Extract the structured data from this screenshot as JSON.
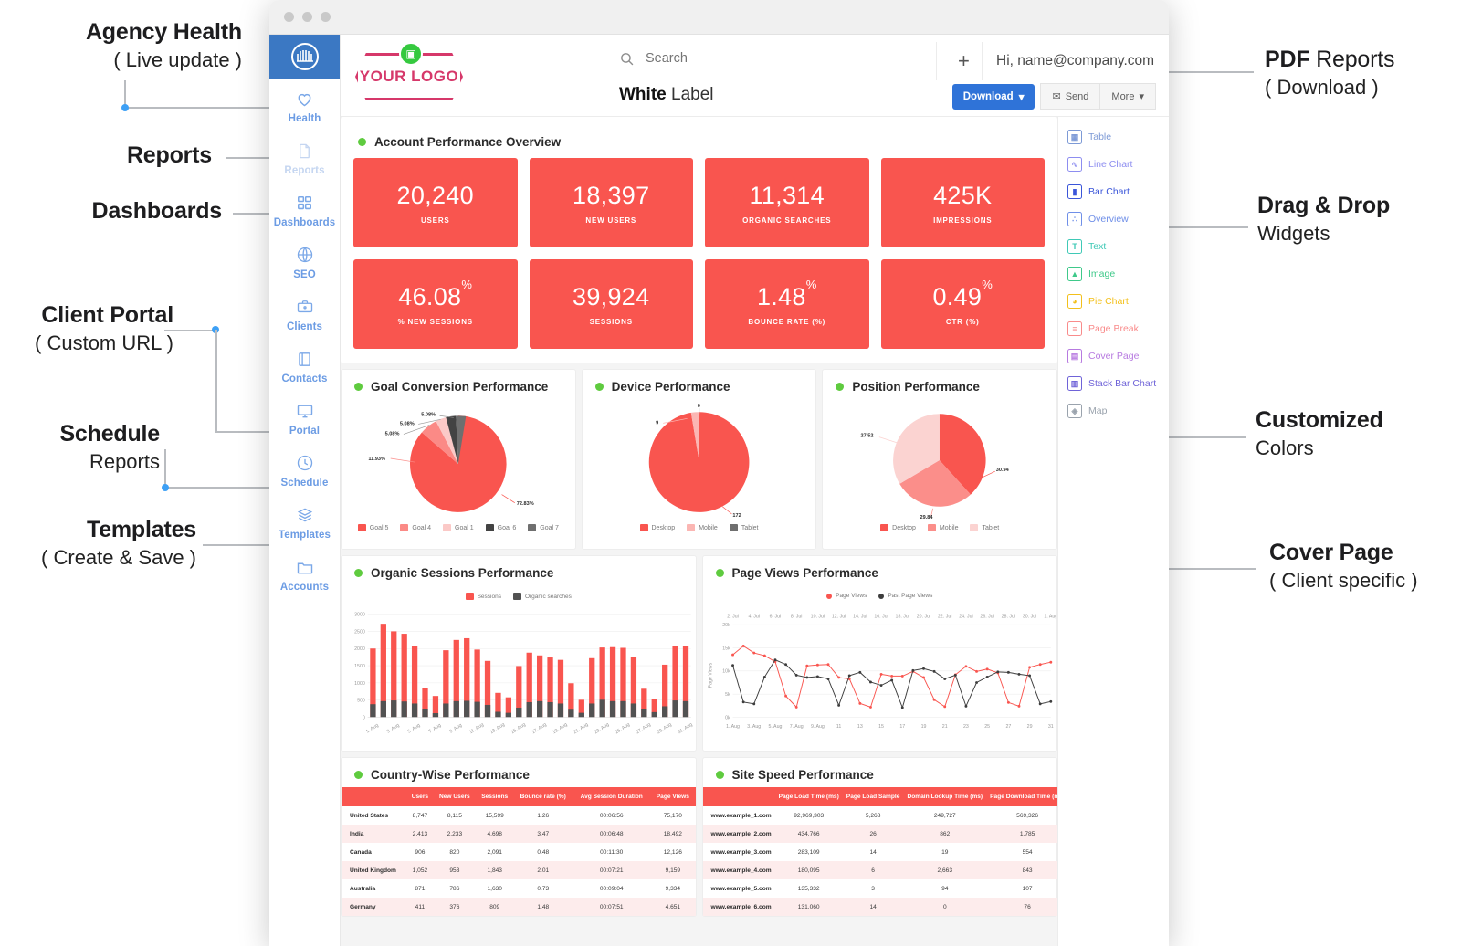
{
  "annotations": {
    "left": [
      {
        "id": "agency-health",
        "title": "Agency Health",
        "title_thin": "",
        "sub": "( Live update )"
      },
      {
        "id": "reports",
        "title": "Reports",
        "sub": ""
      },
      {
        "id": "dashboards",
        "title": "Dashboards",
        "sub": ""
      },
      {
        "id": "client-portal",
        "title": "Client Portal",
        "sub": "( Custom URL )"
      },
      {
        "id": "schedule",
        "title": "Schedule",
        "sub": "Reports"
      },
      {
        "id": "templates",
        "title": "Templates",
        "sub": "( Create & Save )"
      }
    ],
    "right": [
      {
        "id": "pdf-reports",
        "title": "PDF",
        "title_thin": " Reports",
        "sub": "( Download )"
      },
      {
        "id": "drag-drop",
        "title": "Drag & Drop",
        "sub": "Widgets"
      },
      {
        "id": "customized-colors",
        "title": "Customized",
        "sub": "Colors"
      },
      {
        "id": "cover-page",
        "title": "Cover Page",
        "sub": "( Client specific )"
      }
    ]
  },
  "sidebar": {
    "items": [
      {
        "label": "Health",
        "icon": "heart-icon"
      },
      {
        "label": "Reports",
        "icon": "file-icon"
      },
      {
        "label": "Dashboards",
        "icon": "grid-icon"
      },
      {
        "label": "SEO",
        "icon": "globe-icon"
      },
      {
        "label": "Clients",
        "icon": "briefcase-icon"
      },
      {
        "label": "Contacts",
        "icon": "contacts-book-icon"
      },
      {
        "label": "Portal",
        "icon": "monitor-icon"
      },
      {
        "label": "Schedule",
        "icon": "clock-icon"
      },
      {
        "label": "Templates",
        "icon": "layers-icon"
      },
      {
        "label": "Accounts",
        "icon": "folder-icon"
      }
    ]
  },
  "header": {
    "logo_text": "YOUR LOGO",
    "search_placeholder": "Search",
    "search_value": "",
    "plus_label": "+",
    "greeting": "Hi, name@company.com",
    "report_title_bold": "White",
    "report_title_thin": " Label",
    "download_label": "Download",
    "send_label": "Send",
    "more_label": "More"
  },
  "widget_panel": {
    "items": [
      {
        "label": "Table",
        "icon": "table-icon",
        "color": "#7d9ad6",
        "glyph": "▦"
      },
      {
        "label": "Line Chart",
        "icon": "line-chart-icon",
        "color": "#8d8df0",
        "glyph": "∿"
      },
      {
        "label": "Bar Chart",
        "icon": "bar-chart-icon",
        "color": "#3a55d9",
        "glyph": "▮"
      },
      {
        "label": "Overview",
        "icon": "overview-icon",
        "color": "#6f8fe8",
        "glyph": "∴"
      },
      {
        "label": "Text",
        "icon": "text-icon",
        "color": "#3fc9b6",
        "glyph": "T"
      },
      {
        "label": "Image",
        "icon": "image-icon",
        "color": "#3fc98a",
        "glyph": "▲"
      },
      {
        "label": "Pie Chart",
        "icon": "pie-chart-icon",
        "color": "#f3c01b",
        "glyph": "◕"
      },
      {
        "label": "Page Break",
        "icon": "page-break-icon",
        "color": "#f98b8b",
        "glyph": "≡"
      },
      {
        "label": "Cover Page",
        "icon": "cover-page-icon",
        "color": "#b77ae0",
        "glyph": "▤"
      },
      {
        "label": "Stack Bar Chart",
        "icon": "stack-bar-chart-icon",
        "color": "#6f63d8",
        "glyph": "▥"
      },
      {
        "label": "Map",
        "icon": "map-icon",
        "color": "#9aa3ad",
        "glyph": "◈"
      }
    ]
  },
  "overview": {
    "title": "Account Performance Overview",
    "kpis": [
      {
        "value": "20,240",
        "suffix": "",
        "label": "USERS"
      },
      {
        "value": "18,397",
        "suffix": "",
        "label": "NEW USERS"
      },
      {
        "value": "11,314",
        "suffix": "",
        "label": "ORGANIC SEARCHES"
      },
      {
        "value": "425K",
        "suffix": "",
        "label": "IMPRESSIONS"
      },
      {
        "value": "46.08",
        "suffix": "%",
        "label": "% NEW SESSIONS"
      },
      {
        "value": "39,924",
        "suffix": "",
        "label": "SESSIONS"
      },
      {
        "value": "1.48",
        "suffix": "%",
        "label": "BOUNCE RATE (%)"
      },
      {
        "value": "0.49",
        "suffix": "%",
        "label": "CTR (%)"
      }
    ]
  },
  "cards": {
    "goal_conversion": "Goal Conversion Performance",
    "device": "Device Performance",
    "position": "Position Performance",
    "organic_sessions": "Organic Sessions Performance",
    "page_views": "Page Views Performance",
    "country_wise": "Country-Wise Performance",
    "site_speed": "Site Speed Performance"
  },
  "chart_data": [
    {
      "type": "pie",
      "title": "Goal Conversion Performance",
      "categories": [
        "Goal 5",
        "Goal 4",
        "Goal 1",
        "Goal 6",
        "Goal 7"
      ],
      "values": [
        72.83,
        11.93,
        5.08,
        5.08,
        5.08
      ],
      "labels": [
        "72.83%",
        "11.93%",
        "5.08%",
        "5.08%",
        "5.08%"
      ],
      "colors": [
        "#f9554f",
        "#fb8a86",
        "#fbc9c7",
        "#434343",
        "#6f6f6f"
      ],
      "legend": "bottom"
    },
    {
      "type": "pie",
      "title": "Device Performance",
      "categories": [
        "Desktop",
        "Mobile",
        "Tablet"
      ],
      "values": [
        172,
        9,
        0
      ],
      "labels": [
        "172",
        "9",
        "0"
      ],
      "colors": [
        "#f9554f",
        "#fbb6b3",
        "#6f6f6f"
      ],
      "legend": "bottom"
    },
    {
      "type": "pie",
      "title": "Position Performance",
      "categories": [
        "Desktop",
        "Mobile",
        "Tablet"
      ],
      "values": [
        30.94,
        29.84,
        27.52
      ],
      "labels": [
        "30.94",
        "29.84",
        "27.52"
      ],
      "colors": [
        "#f9554f",
        "#fb8e8a",
        "#fbd3d1"
      ],
      "legend": "bottom"
    },
    {
      "type": "bar",
      "title": "Organic Sessions Performance",
      "xlabel": "",
      "ylabel": "",
      "ylim": [
        0,
        3000
      ],
      "yticks": [
        "0",
        "500",
        "1000",
        "1500",
        "2000",
        "2500",
        "3000"
      ],
      "categories": [
        "1. Aug",
        "3. Aug",
        "5. Aug",
        "7. Aug",
        "9. Aug",
        "11. Aug",
        "13. Aug",
        "15. Aug",
        "17. Aug",
        "19. Aug",
        "21. Aug",
        "23. Aug",
        "25. Aug",
        "27. Aug",
        "29. Aug",
        "31. Aug"
      ],
      "series": [
        {
          "name": "Sessions",
          "color": "#f9554f",
          "values": [
            2000,
            2720,
            2500,
            2430,
            2080,
            860,
            620,
            1950,
            2250,
            2300,
            1970,
            1640,
            710,
            580,
            1490,
            1880,
            1800,
            1740,
            1670,
            990,
            510,
            1720,
            2030,
            2040,
            2020,
            1760,
            830,
            530,
            1530,
            2080,
            2060
          ]
        },
        {
          "name": "Organic searches",
          "color": "#525252",
          "values": [
            380,
            470,
            490,
            460,
            400,
            230,
            120,
            400,
            470,
            480,
            450,
            360,
            160,
            130,
            280,
            440,
            470,
            440,
            400,
            220,
            130,
            400,
            510,
            470,
            470,
            400,
            230,
            150,
            320,
            490,
            470
          ]
        }
      ],
      "legend": "top"
    },
    {
      "type": "line",
      "title": "Page Views Performance",
      "ylabel": "Page Views",
      "ylim": [
        0,
        20000
      ],
      "yticks": [
        "0k",
        "5k",
        "10k",
        "15k",
        "20k"
      ],
      "x_bottom": [
        "1. Aug",
        "3. Aug",
        "5. Aug",
        "7. Aug",
        "9. Aug",
        "11",
        "13",
        "15",
        "17",
        "19",
        "21",
        "23",
        "25",
        "27",
        "29",
        "31"
      ],
      "x_top": [
        "2. Jul",
        "4. Jul",
        "6. Jul",
        "8. Jul",
        "10. Jul",
        "12. Jul",
        "14. Jul",
        "16. Jul",
        "18. Jul",
        "20. Jul",
        "22. Jul",
        "24. Jul",
        "26. Jul",
        "28. Jul",
        "30. Jul",
        "1. Aug"
      ],
      "series": [
        {
          "name": "Page Views",
          "color": "#f9554f",
          "values": [
            13500,
            15400,
            13900,
            13300,
            12000,
            4600,
            2200,
            11100,
            11300,
            11400,
            8600,
            8300,
            3000,
            2200,
            9300,
            8900,
            8900,
            9900,
            8600,
            3800,
            2300,
            9200,
            11000,
            9900,
            10400,
            9600,
            3200,
            2400,
            10800,
            11400,
            11900
          ]
        },
        {
          "name": "Past Page Views",
          "color": "#3d3d3d",
          "values": [
            11200,
            3300,
            2900,
            8700,
            12400,
            11400,
            9100,
            8600,
            8800,
            8300,
            2600,
            9000,
            9700,
            7600,
            6900,
            8000,
            2100,
            10100,
            10500,
            9900,
            8300,
            9100,
            2400,
            7500,
            8700,
            9800,
            9700,
            9300,
            9000,
            2900,
            3400
          ]
        }
      ],
      "legend": "top"
    },
    {
      "type": "table",
      "title": "Country-Wise Performance",
      "columns": [
        "",
        "Users",
        "New Users",
        "Sessions",
        "Bounce rate (%)",
        "Avg Session Duration",
        "Page Views"
      ],
      "rows": [
        [
          "United States",
          "8,747",
          "8,115",
          "15,599",
          "1.26",
          "00:06:56",
          "75,170"
        ],
        [
          "India",
          "2,413",
          "2,233",
          "4,698",
          "3.47",
          "00:06:48",
          "18,492"
        ],
        [
          "Canada",
          "906",
          "820",
          "2,091",
          "0.48",
          "00:11:30",
          "12,126"
        ],
        [
          "United Kingdom",
          "1,052",
          "953",
          "1,843",
          "2.01",
          "00:07:21",
          "9,159"
        ],
        [
          "Australia",
          "871",
          "786",
          "1,630",
          "0.73",
          "00:09:04",
          "9,334"
        ],
        [
          "Germany",
          "411",
          "376",
          "809",
          "1.48",
          "00:07:51",
          "4,651"
        ]
      ]
    },
    {
      "type": "table",
      "title": "Site Speed Performance",
      "columns": [
        "",
        "Page Load Time (ms)",
        "Page Load Sample",
        "Domain Lookup Time (ms)",
        "Page Download Time (ms)"
      ],
      "rows": [
        [
          "www.example_1.com",
          "92,969,303",
          "5,268",
          "249,727",
          "569,326"
        ],
        [
          "www.example_2.com",
          "434,766",
          "26",
          "862",
          "1,785"
        ],
        [
          "www.example_3.com",
          "283,109",
          "14",
          "19",
          "554"
        ],
        [
          "www.example_4.com",
          "180,095",
          "6",
          "2,663",
          "843"
        ],
        [
          "www.example_5.com",
          "135,332",
          "3",
          "94",
          "107"
        ],
        [
          "www.example_6.com",
          "131,060",
          "14",
          "0",
          "76"
        ]
      ]
    }
  ],
  "colors": {
    "accent_red": "#f9554f",
    "accent_blue": "#2f73d8",
    "nav_blue": "#7ba8e8",
    "green_dot": "#5fcb3f",
    "logo_pink": "#d6386a"
  }
}
